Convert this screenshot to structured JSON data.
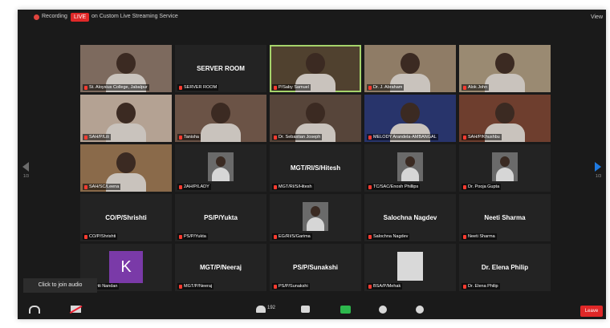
{
  "topbar": {
    "recording": "Recording",
    "live": "LIVE",
    "stream": "on Custom Live Streaming Service",
    "view": "View"
  },
  "tiles": [
    {
      "name": "",
      "label": "St. Aloysius College, Jabalpur",
      "kind": "video",
      "bg": "#7d6a5e"
    },
    {
      "name": "SERVER ROOM",
      "label": "SERVER ROOM",
      "kind": "name",
      "bg": "#232323"
    },
    {
      "name": "",
      "label": "P/Saby Samuel",
      "kind": "video",
      "bg": "#50412f",
      "active": true
    },
    {
      "name": "",
      "label": "Dr. J. Abraham",
      "kind": "video",
      "bg": "#8f7c66"
    },
    {
      "name": "",
      "label": "Alok John",
      "kind": "video",
      "bg": "#9a8a72"
    },
    {
      "name": "",
      "label": "SAH/P/Lili",
      "kind": "video",
      "bg": "#b4a293"
    },
    {
      "name": "",
      "label": "Tanisha",
      "kind": "video",
      "bg": "#6b5346"
    },
    {
      "name": "",
      "label": "Dr. Sebastian Joseph",
      "kind": "video",
      "bg": "#57453a"
    },
    {
      "name": "",
      "label": "MELODY Arandela-AMBANGAL",
      "kind": "video",
      "bg": "#28346b"
    },
    {
      "name": "",
      "label": "SAH/P/Khushbu",
      "kind": "video",
      "bg": "#6e3e2e"
    },
    {
      "name": "",
      "label": "SAH/SC/Leena",
      "kind": "video",
      "bg": "#8a6a4a"
    },
    {
      "name": "",
      "label": "2AH/P/LADY",
      "kind": "thumb",
      "bg": "#232323"
    },
    {
      "name": "MGT/RI/S/Hitesh",
      "label": "MGT/RI/S/Hitesh",
      "kind": "name",
      "bg": "#232323"
    },
    {
      "name": "",
      "label": "TC/SAC/Enosh Phillips",
      "kind": "thumb",
      "bg": "#232323"
    },
    {
      "name": "",
      "label": "Dr. Pooja Gupta",
      "kind": "thumb",
      "bg": "#232323"
    },
    {
      "name": "CO/P/Shrishti",
      "label": "CO/P/Shrishti",
      "kind": "name",
      "bg": "#232323"
    },
    {
      "name": "PS/P/Yukta",
      "label": "PS/P/Yukta",
      "kind": "name",
      "bg": "#232323"
    },
    {
      "name": "",
      "label": "EG/RI/S/Garima",
      "kind": "thumb",
      "bg": "#232323"
    },
    {
      "name": "Salochna Nagdev",
      "label": "Salochna Nagdev",
      "kind": "name",
      "bg": "#232323"
    },
    {
      "name": "Neeti Sharma",
      "label": "Neeti Sharma",
      "kind": "name",
      "bg": "#232323"
    },
    {
      "name": "",
      "label": "A/Kriti Nandan",
      "kind": "avatar",
      "avatar": "K",
      "bg": "#232323"
    },
    {
      "name": "MGT/P/Neeraj",
      "label": "MGT/P/Neeraj",
      "kind": "name",
      "bg": "#232323"
    },
    {
      "name": "PS/P/Sunakshi",
      "label": "PS/P/Sunakshi",
      "kind": "name",
      "bg": "#232323"
    },
    {
      "name": "",
      "label": "BSA/P/Mehak",
      "kind": "blank",
      "bg": "#232323"
    },
    {
      "name": "Dr. Elena Philip",
      "label": "Dr. Elena Philip",
      "kind": "name",
      "bg": "#232323"
    }
  ],
  "paging": {
    "left": "1/3",
    "right": "1/3"
  },
  "tooltip": "Click to join audio",
  "toolbar": {
    "participants_count": "192",
    "leave": "Leave"
  },
  "colors": {
    "active_speaker": "#a6d36b",
    "leave": "#e02828",
    "share": "#2db84d",
    "next_page_arrow": "#1f7ae0"
  }
}
